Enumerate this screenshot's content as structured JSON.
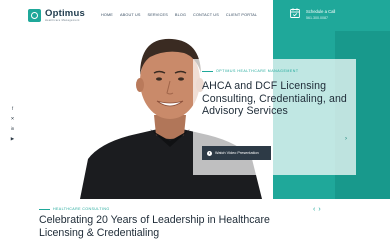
{
  "brand": {
    "name": "Optimus",
    "tagline": "Healthcare Management"
  },
  "nav": {
    "items": [
      "HOME",
      "ABOUT US",
      "SERVICES",
      "BLOG",
      "CONTACT US",
      "CLIENT PORTAL"
    ]
  },
  "schedule": {
    "title": "Schedule a Call",
    "phone": "561.300.0087"
  },
  "hero": {
    "eyebrow": "OPTIMUS HEALTHCARE MANAGEMENT",
    "title": "AHCA and DCF Licensing Consulting, Credentialing, and Advisory Services",
    "video_button": "Watch Video Presentation",
    "arrow": "›"
  },
  "social": {
    "facebook": "f",
    "twitter": "✕",
    "linkedin": "in",
    "youtube": "▶"
  },
  "section": {
    "eyebrow": "HEALTHCARE CONSULTING",
    "title": "Celebrating 20 Years of Leadership in Healthcare Licensing & Credentialing",
    "prev": "‹",
    "next": "›"
  },
  "colors": {
    "accent": "#1fa89a",
    "dark": "#1e2b37"
  }
}
